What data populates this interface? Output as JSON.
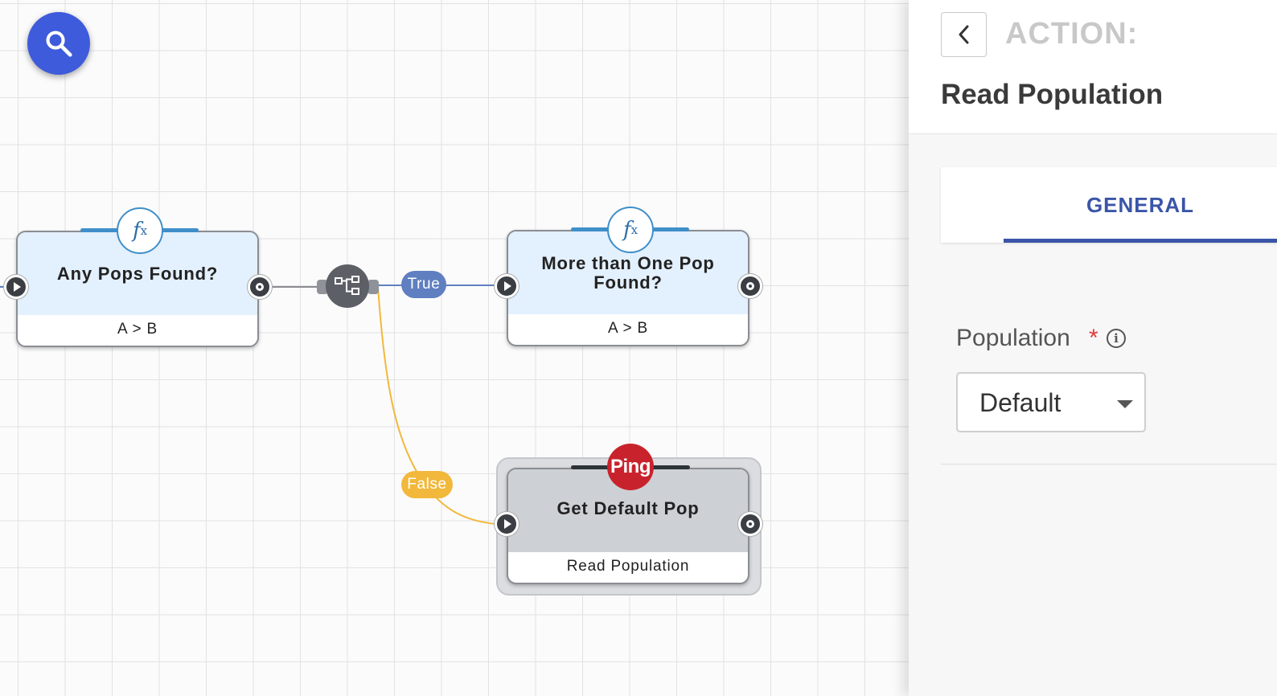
{
  "canvas": {
    "search_icon": "search-icon",
    "nodes": {
      "any_pops": {
        "title": "Any Pops Found?",
        "subtitle": "A > B",
        "badge": "fx"
      },
      "more_than_one": {
        "title": "More than One Pop Found?",
        "subtitle": "A > B",
        "badge": "fx"
      },
      "get_default": {
        "title": "Get Default Pop",
        "subtitle": "Read Population",
        "badge": "Ping"
      }
    },
    "branch_labels": {
      "true": "True",
      "false": "False"
    },
    "colors": {
      "true_wire": "#5f7fc0",
      "false_wire": "#f2b83c",
      "fab": "#3e5bdb",
      "ping_badge": "#c8232c"
    }
  },
  "panel": {
    "back_icon": "chevron-left-icon",
    "action_label": "ACTION:",
    "title": "Read Population",
    "tabs": [
      {
        "label": "GENERAL",
        "active": true
      }
    ],
    "fields": {
      "population": {
        "label": "Population",
        "required_mark": "*",
        "info_glyph": "i",
        "value": "Default"
      }
    },
    "colors": {
      "accent": "#3a55a8",
      "required": "#e23b3b"
    }
  }
}
